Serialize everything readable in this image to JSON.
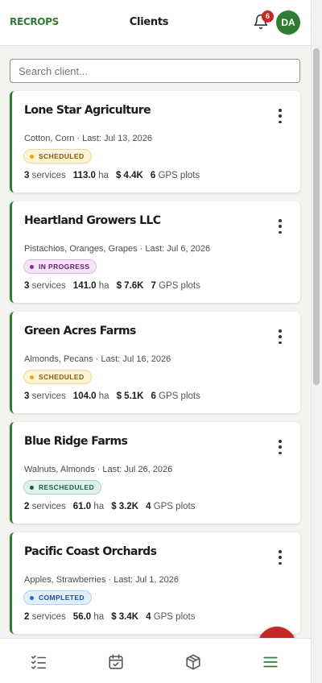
{
  "header": {
    "brand": "RECROPS",
    "title": "Clients",
    "notification_count": "6",
    "avatar_initials": "DA"
  },
  "search": {
    "placeholder": "Search client..."
  },
  "clients": [
    {
      "name": "Lone Star Agriculture",
      "crops_last": "Cotton, Corn · Last: Jul 13, 2026",
      "status": "SCHEDULED",
      "services": "3",
      "services_label": "services",
      "hectares": "113.0",
      "hectares_label": "ha",
      "amount": "$ 4.4K",
      "gps_plots": "6",
      "gps_label": "GPS plots"
    },
    {
      "name": "Heartland Growers LLC",
      "crops_last": "Pistachios, Oranges, Grapes · Last: Jul 6, 2026",
      "status": "IN PROGRESS",
      "services": "3",
      "services_label": "services",
      "hectares": "141.0",
      "hectares_label": "ha",
      "amount": "$ 7.6K",
      "gps_plots": "7",
      "gps_label": "GPS plots"
    },
    {
      "name": "Green Acres Farms",
      "crops_last": "Almonds, Pecans · Last: Jul 16, 2026",
      "status": "SCHEDULED",
      "services": "3",
      "services_label": "services",
      "hectares": "104.0",
      "hectares_label": "ha",
      "amount": "$ 5.1K",
      "gps_plots": "6",
      "gps_label": "GPS plots"
    },
    {
      "name": "Blue Ridge Farms",
      "crops_last": "Walnuts, Almonds · Last: Jul 26, 2026",
      "status": "RESCHEDULED",
      "services": "2",
      "services_label": "services",
      "hectares": "61.0",
      "hectares_label": "ha",
      "amount": "$ 3.2K",
      "gps_plots": "4",
      "gps_label": "GPS plots"
    },
    {
      "name": "Pacific Coast Orchards",
      "crops_last": "Apples, Strawberries · Last: Jul 1, 2026",
      "status": "COMPLETED",
      "services": "2",
      "services_label": "services",
      "hectares": "56.0",
      "hectares_label": "ha",
      "amount": "$ 3.4K",
      "gps_plots": "4",
      "gps_label": "GPS plots"
    }
  ],
  "colors": {
    "brand_green": "#2e7d32",
    "alert_red": "#c62828",
    "background": "#f3f4ef"
  },
  "bottom_nav": {
    "items": [
      "checklist-icon",
      "calendar-check-icon",
      "package-icon",
      "menu-icon"
    ],
    "active": "menu-icon"
  },
  "fab_icon": "add-icon"
}
